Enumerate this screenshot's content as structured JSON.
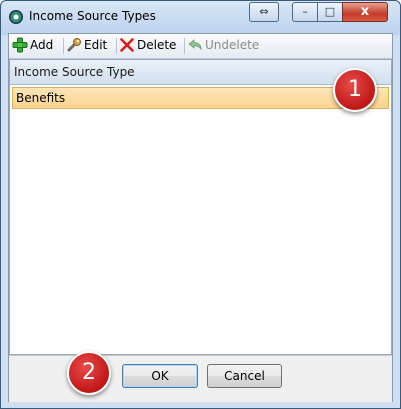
{
  "window": {
    "title": "Income Source Types",
    "controls": {
      "restore": "⇔",
      "minimize": "–",
      "maximize": "□",
      "close": "x"
    }
  },
  "toolbar": {
    "add_label": "Add",
    "edit_label": "Edit",
    "delete_label": "Delete",
    "undelete_label": "Undelete",
    "undelete_enabled": false
  },
  "grid": {
    "column_header": "Income Source Type",
    "rows": [
      {
        "label": "Benefits",
        "selected": true
      }
    ]
  },
  "annotations": {
    "badge_1": "1",
    "badge_2": "2"
  },
  "footer": {
    "ok_label": "OK",
    "cancel_label": "Cancel"
  },
  "colors": {
    "selection": "#fbd38e",
    "badge": "#c01616",
    "title_gradient": "#bcd3ec"
  }
}
